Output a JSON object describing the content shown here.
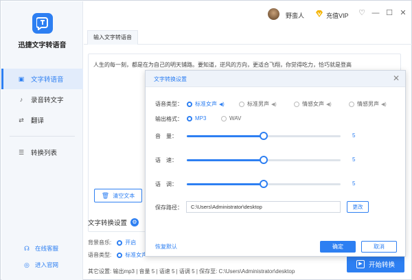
{
  "app": {
    "name": "迅捷文字转语音",
    "accent": "#2d7ff2"
  },
  "sidebar": {
    "items": [
      {
        "label": "文字转语音",
        "icon": "text-to-speech-icon",
        "active": true
      },
      {
        "label": "录音转文字",
        "icon": "microphone-icon",
        "active": false
      },
      {
        "label": "翻译",
        "icon": "translate-icon",
        "active": false
      },
      {
        "label": "转换列表",
        "icon": "list-icon",
        "active": false
      }
    ],
    "bottom_links": [
      {
        "label": "在线客服",
        "icon": "headset-icon"
      },
      {
        "label": "进入官网",
        "icon": "globe-icon"
      }
    ]
  },
  "titlebar": {
    "username": "野蛮人",
    "vip_label": "充值VIP"
  },
  "main": {
    "tab_label": "输入文字转语音",
    "editor_text": "人生的每一刻，都是在为自己的明天铺路。要知道，逆风的方向，更适合飞翔，你觉得吃力，恰巧就是登高",
    "clear_label": "清空文本",
    "settings_title": "文字转换设置",
    "bg_music_label": "背景音乐:",
    "bg_music_value": "开启",
    "voice_type_label": "语音类型:",
    "voice_type_value": "标准女声",
    "status_text": "其它设置:  输出mp3  |  音量 5  |  语速 5  |  语调 5  |  保存至: C:\\Users\\Administrator\\desktop",
    "start_label": "开始转换"
  },
  "dialog": {
    "title": "文字转换设置",
    "voice_label": "语音类型：",
    "voice_options": [
      {
        "label": "标准女声",
        "selected": true
      },
      {
        "label": "标准男声",
        "selected": false
      },
      {
        "label": "情感女声",
        "selected": false
      },
      {
        "label": "情感男声",
        "selected": false
      }
    ],
    "format_label": "输出格式：",
    "format_options": [
      {
        "label": "MP3",
        "selected": true
      },
      {
        "label": "WAV",
        "selected": false
      }
    ],
    "sliders": [
      {
        "label": "音　量：",
        "value": "5",
        "level": 0.5
      },
      {
        "label": "语　速：",
        "value": "5",
        "level": 0.5
      },
      {
        "label": "语　调：",
        "value": "5",
        "level": 0.5
      }
    ],
    "path_label": "保存路径：",
    "path_value": "C:\\Users\\Administrator\\desktop",
    "change_label": "更改",
    "restore_label": "恢复默认",
    "ok_label": "确定",
    "cancel_label": "取消"
  }
}
